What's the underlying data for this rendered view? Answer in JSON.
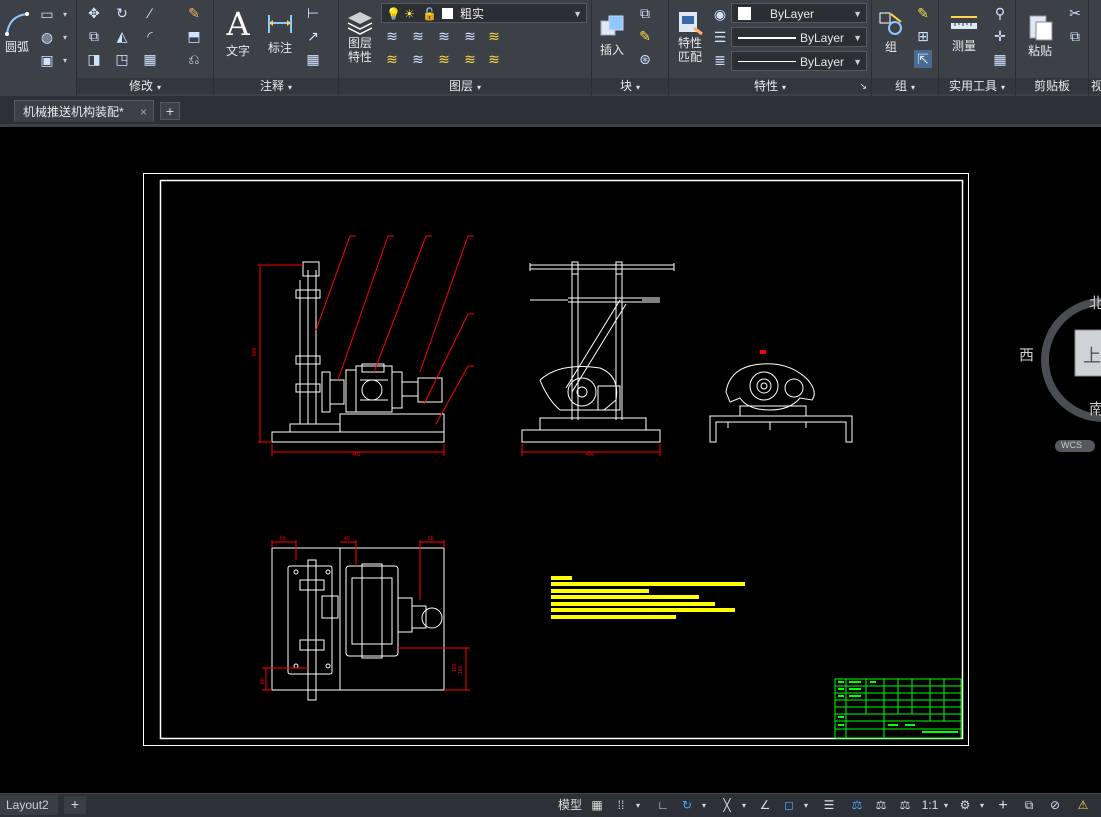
{
  "ribbon": {
    "draw_panel": {
      "arc_label": "圆弧"
    },
    "modify_panel": {
      "title": "修改"
    },
    "annotation_panel": {
      "title": "注释",
      "text_label": "文字",
      "dimension_label": "标注"
    },
    "layers_panel": {
      "title": "图层",
      "layer_props_label": "图层\n特性",
      "current_layer": "粗实"
    },
    "block_panel": {
      "title": "块",
      "insert_label": "插入"
    },
    "properties_panel": {
      "title": "特性",
      "match_label": "特性\n匹配",
      "color_value": "ByLayer",
      "linetype_value": "ByLayer",
      "lineweight_value": "ByLayer"
    },
    "groups_panel": {
      "title": "组",
      "group_label": "组"
    },
    "utilities_panel": {
      "title": "实用工具",
      "measure_label": "测量"
    },
    "clipboard_panel": {
      "title": "剪贴板",
      "paste_label": "粘贴"
    },
    "view_panel_stub": {
      "title": "视"
    }
  },
  "tabs": {
    "document_tab": "机械推送机构装配*",
    "close_glyph": "×",
    "new_tab_glyph": "+"
  },
  "viewcube": {
    "north": "北",
    "west": "西",
    "south": "南",
    "top_face": "上",
    "wcs": "WCS"
  },
  "drawing": {
    "dim_side_height": "500",
    "dim_side_width": "400",
    "dim_front_width": "400",
    "dim_plan_a": "60",
    "dim_plan_b": "40",
    "dim_plan_c": "60",
    "dim_plan_right1": "150",
    "dim_plan_right2": "100",
    "dim_plan_left": "60",
    "line_color": "#ffffff",
    "dim_color": "#ff0000",
    "note_color": "#ffff00",
    "title_block_color": "#00ff00"
  },
  "statusbar": {
    "layout_tab": "Layout2",
    "add_layout": "+",
    "model_label": "模型",
    "scale_label": "1:1"
  }
}
